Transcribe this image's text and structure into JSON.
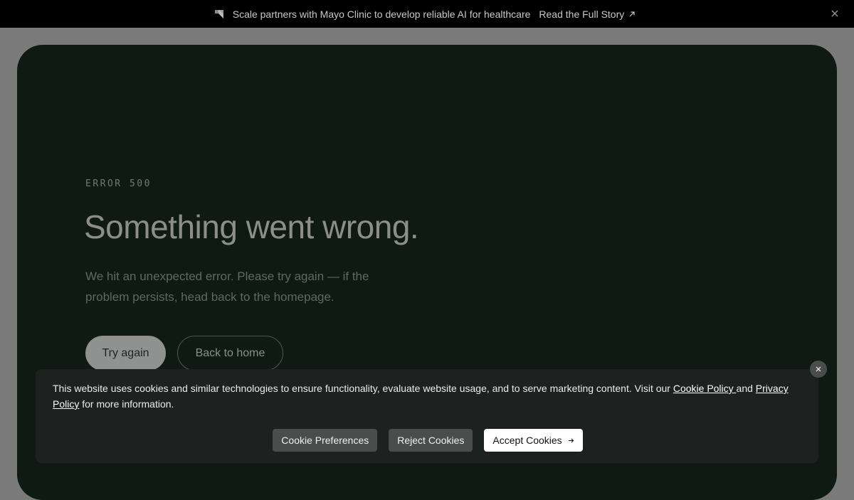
{
  "banner": {
    "logo_icon": "scale-logo-icon",
    "message": "Scale partners with Mayo Clinic to develop reliable AI for healthcare",
    "link_label": "Read the Full Story",
    "link_icon": "arrow-up-right-icon",
    "close_icon": "close-icon"
  },
  "error": {
    "code": "ERROR 500",
    "title": "Something went wrong.",
    "description": "We hit an unexpected error. Please try again — if the problem persists, head back to the homepage.",
    "try_again_label": "Try again",
    "back_home_label": "Back to home"
  },
  "cookie": {
    "text_before": "This website uses cookies and similar technologies to ensure functionality, evaluate website usage, and to serve marketing content. Visit our ",
    "cookie_policy_label": "Cookie Policy ",
    "and_text": "and ",
    "privacy_policy_label": "Privacy Policy",
    "text_after": " for more information.",
    "preferences_label": "Cookie Preferences",
    "reject_label": "Reject Cookies",
    "accept_label": "Accept Cookies",
    "accept_icon": "arrow-right-icon",
    "close_icon": "close-icon"
  },
  "colors": {
    "banner_bg": "#000000",
    "card_bg": "#0f1a14",
    "overlay": "#7a7a7a",
    "cookie_bg": "#1d211f"
  }
}
